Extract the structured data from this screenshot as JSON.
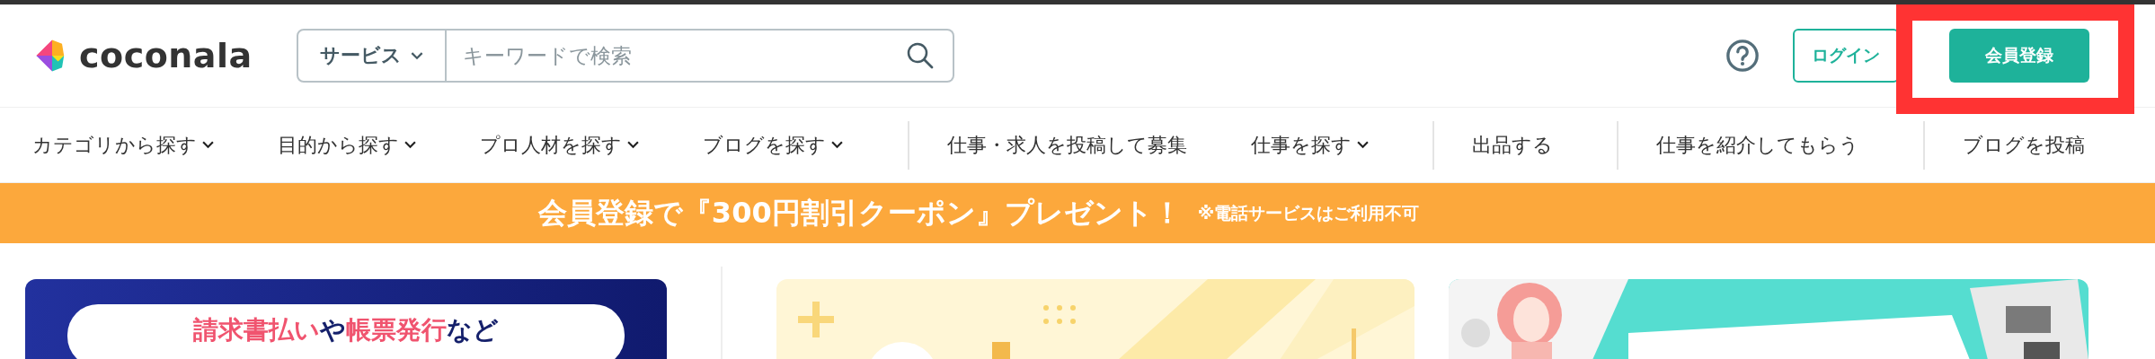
{
  "header": {
    "logo": "coconala",
    "search": {
      "category": "サービス",
      "placeholder": "キーワードで検索"
    },
    "login": "ログイン",
    "register": "会員登録",
    "highlight_frame": true
  },
  "nav": [
    {
      "label": "カテゴリから探す",
      "has_menu": true,
      "divider_before": false
    },
    {
      "label": "目的から探す",
      "has_menu": true,
      "divider_before": false
    },
    {
      "label": "プロ人材を探す",
      "has_menu": true,
      "divider_before": false
    },
    {
      "label": "ブログを探す",
      "has_menu": true,
      "divider_before": false
    },
    {
      "label": "仕事・求人を投稿して募集",
      "has_menu": false,
      "divider_before": true
    },
    {
      "label": "仕事を探す",
      "has_menu": true,
      "divider_before": false
    },
    {
      "label": "出品する",
      "has_menu": false,
      "divider_before": true
    },
    {
      "label": "仕事を紹介してもらう",
      "has_menu": false,
      "divider_before": true
    },
    {
      "label": "ブログを投稿",
      "has_menu": false,
      "divider_before": true
    }
  ],
  "banner": {
    "headline": "会員登録で『300円割引クーポン』プレゼント！",
    "note": "※電話サービスはご利用不可"
  },
  "cards": [
    {
      "kind": "promo",
      "pill": [
        {
          "text": "請求書払い",
          "accent": true
        },
        {
          "text": "や",
          "accent": false
        },
        {
          "text": "帳票発行",
          "accent": true
        },
        {
          "text": "など",
          "accent": false
        }
      ]
    },
    {
      "kind": "picture"
    },
    {
      "kind": "picture"
    }
  ]
}
